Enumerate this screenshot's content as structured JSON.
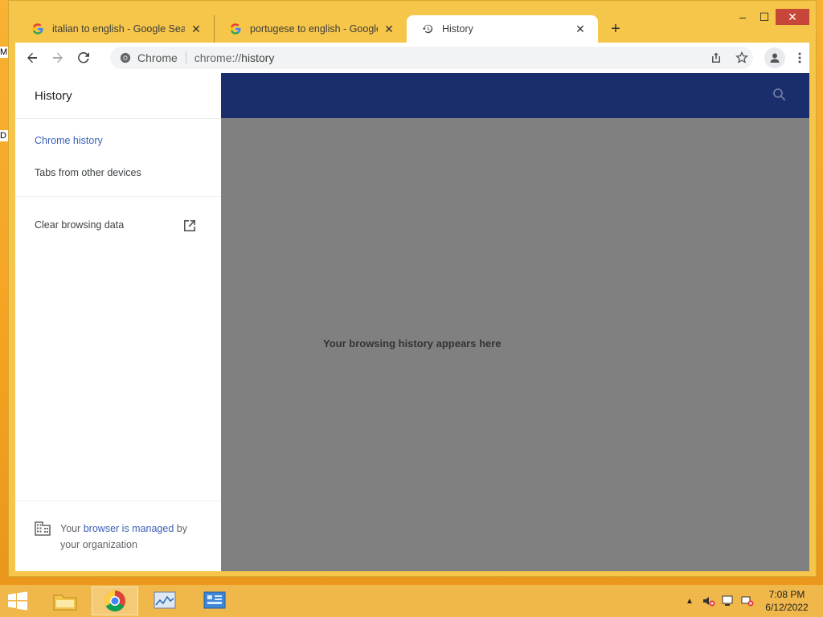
{
  "desktop": {
    "frag1": "M",
    "frag2": "D"
  },
  "window": {
    "controls": {
      "minimize": "–",
      "maximize": "☐",
      "close": "✕"
    }
  },
  "tabs": [
    {
      "title": "italian to english - Google Search",
      "icon": "google-icon"
    },
    {
      "title": "portugese to english - Google Search",
      "icon": "google-icon"
    },
    {
      "title": "History",
      "icon": "history-icon"
    }
  ],
  "toolbar": {
    "omnibox_chip": "Chrome",
    "url_scheme": "chrome://",
    "url_path": "history"
  },
  "sidebar": {
    "title": "History",
    "items": [
      {
        "label": "Chrome history"
      },
      {
        "label": "Tabs from other devices"
      },
      {
        "label": "Clear browsing data"
      }
    ],
    "managed": {
      "prefix": "Your ",
      "link": "browser is managed",
      "suffix": " by your organization"
    }
  },
  "main": {
    "empty_message": "Your browsing history appears here"
  },
  "taskbar": {
    "clock_time": "7:08 PM",
    "clock_date": "6/12/2022"
  },
  "colors": {
    "header_blue": "#1a2d6c",
    "accent_blue": "#3a5fb4",
    "overlay_gray": "#808080"
  }
}
